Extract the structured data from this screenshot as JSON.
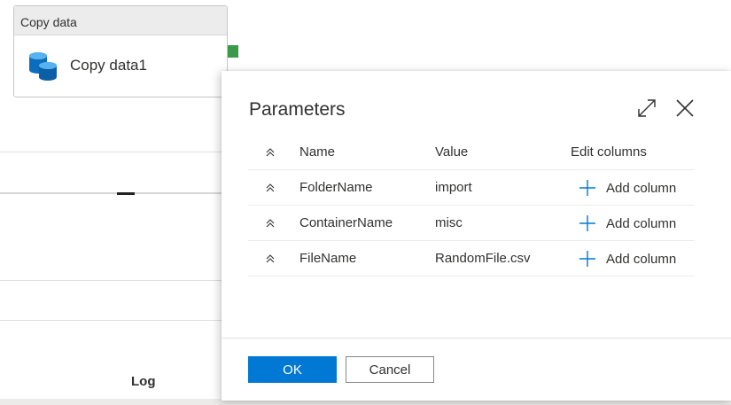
{
  "activity": {
    "type_label": "Copy data",
    "name": "Copy data1",
    "icon": "database-copy-icon"
  },
  "background": {
    "log_label": "Log"
  },
  "dialog": {
    "title": "Parameters",
    "expand_icon": "expand-diagonal-icon",
    "close_icon": "close-icon",
    "columns": {
      "name": "Name",
      "value": "Value",
      "edit": "Edit columns"
    },
    "rows": [
      {
        "name": "FolderName",
        "value": "import",
        "add_label": "Add column"
      },
      {
        "name": "ContainerName",
        "value": "misc",
        "add_label": "Add column"
      },
      {
        "name": "FileName",
        "value": "RandomFile.csv",
        "add_label": "Add column"
      }
    ],
    "ok_label": "OK",
    "cancel_label": "Cancel"
  },
  "colors": {
    "primary": "#0078d4",
    "port_green": "#3b9a4a",
    "db_blue": "#0a6ebd"
  }
}
